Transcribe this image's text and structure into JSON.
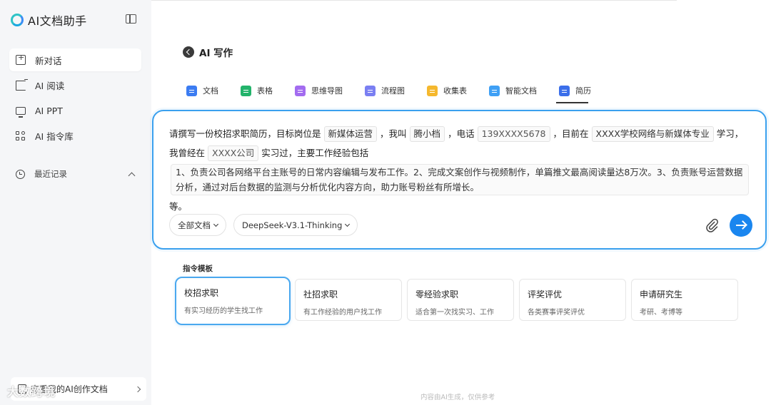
{
  "sidebar": {
    "brand": "AI文档助手",
    "nav": [
      {
        "label": "新对话",
        "active": true
      },
      {
        "label": "AI 阅读"
      },
      {
        "label": "AI PPT"
      },
      {
        "label": "AI 指令库"
      }
    ],
    "recent_label": "最近记录",
    "bottom_card": "查看我的AI创作文档",
    "watermark": "大数跨境"
  },
  "main": {
    "back_title": "AI 写作",
    "tabs": [
      {
        "label": "文档",
        "color": "#3b7cf2"
      },
      {
        "label": "表格",
        "color": "#23b36b"
      },
      {
        "label": "思维导图",
        "color": "#a36cf0"
      },
      {
        "label": "流程图",
        "color": "#7a7ff2"
      },
      {
        "label": "收集表",
        "color": "#f5b82e"
      },
      {
        "label": "智能文档",
        "color": "#3fa0f5"
      },
      {
        "label": "简历",
        "color": "#3b6fea",
        "active": true
      }
    ],
    "prompt": {
      "t1": "请撰写一份校招求职简历，目标岗位是",
      "s1": "新媒体运营",
      "t2": "，我叫",
      "s2": "腾小档",
      "t3": "，电话",
      "s3": "139XXXX5678",
      "t4": "，目前在",
      "s4": "XXXX学校网络与新媒体专业",
      "t5": "学习，我曾经在",
      "s5": "XXXX公司",
      "t6": "实习过，主要工作经验包括",
      "s6": "1、负责公司各网络平台主账号的日常内容编辑与发布工作。2、完成文案创作与视频制作，单篇推文最高阅读量达8万次。3、负责账号运营数据分析，通过对后台数据的监测与分析优化内容方向，助力账号粉丝有所增长。",
      "t7": "等。"
    },
    "doc_select": "全部文档",
    "model_select": "DeepSeek-V3.1-Thinking",
    "templates_label": "指令模板",
    "templates": [
      {
        "title": "校招求职",
        "desc": "有实习经历的学生找工作",
        "active": true
      },
      {
        "title": "社招求职",
        "desc": "有工作经验的用户找工作"
      },
      {
        "title": "零经验求职",
        "desc": "适合第一次找实习、工作"
      },
      {
        "title": "评奖评优",
        "desc": "各类赛事评奖评优"
      },
      {
        "title": "申请研究生",
        "desc": "考研、考博等"
      }
    ],
    "footer_note": "内容由AI生成，仅供参考"
  },
  "colors": {
    "accent": "#1a86ef",
    "sidebar_bg": "#f5f6f8"
  }
}
